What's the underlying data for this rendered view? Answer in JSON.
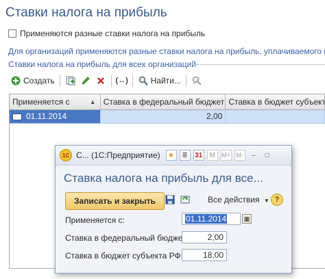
{
  "page": {
    "title": "Ставки налога на прибыль",
    "checkbox_label": "Применяются разные ставки налога на прибыль",
    "info_text": "Для организаций применяются разные ставки налога на прибыль, уплачиваемого в бю",
    "group_title": "Ставки налога на прибыль для всех организаций"
  },
  "toolbar": {
    "create_label": "Создать",
    "find_label": "Найти..."
  },
  "grid": {
    "columns": [
      "Применяется с",
      "Ставка в федеральный бюджет",
      "Ставка в бюджет субъекта"
    ],
    "rows": [
      {
        "date": "01.11.2014",
        "federal": "2,00",
        "subject": ""
      }
    ]
  },
  "dialog": {
    "window_title": "С...  (1С:Предприятие)",
    "logo_text": "1С",
    "toolbar_icons": [
      "star-icon",
      "list-icon",
      "calendar-icon",
      "M",
      "M+",
      "M-"
    ],
    "heading": "Ставка налога на прибыль для все...",
    "save_close_label": "Записать и закрыть",
    "all_actions_label": "Все действия",
    "help_label": "?",
    "date_label": "Применяется с:",
    "date_value": "01.11.2014",
    "federal_label": "Ставка в федеральный бюджет:",
    "federal_value": "2,00",
    "subject_label": "Ставка в бюджет субъекта РФ:",
    "subject_value": "18,00"
  },
  "colors": {
    "accent_blue": "#3a5b8c",
    "selection": "#4a78c2",
    "row_highlight": "#cfe1f7",
    "save_button": "#f0c86a"
  }
}
